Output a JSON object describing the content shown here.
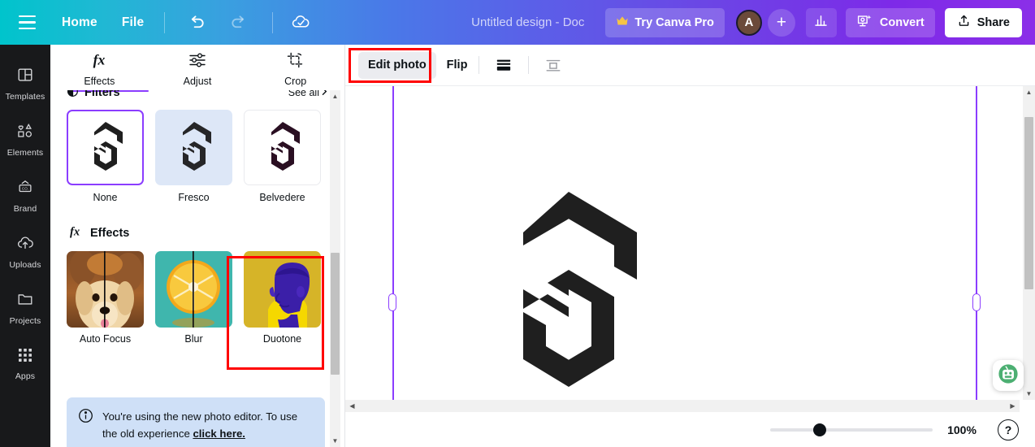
{
  "header": {
    "menu_icon": "hamburger-icon",
    "home_label": "Home",
    "file_label": "File",
    "undo_icon": "undo-icon",
    "redo_icon": "redo-icon",
    "cloud_save_icon": "cloud-check-icon",
    "doc_title": "Untitled design - Doc",
    "try_pro_label": "Try Canva Pro",
    "crown_icon": "crown-icon",
    "avatar_initial": "A",
    "add_member_label": "+",
    "insights_icon": "bar-chart-icon",
    "convert_label": "Convert",
    "convert_icon": "magic-convert-icon",
    "share_label": "Share",
    "share_icon": "share-upload-icon",
    "gradient_start": "#00c4cc",
    "gradient_end": "#8b2fe8"
  },
  "rail": {
    "items": [
      {
        "label": "Templates",
        "icon": "templates-icon"
      },
      {
        "label": "Elements",
        "icon": "elements-shapes-icon"
      },
      {
        "label": "Brand",
        "icon": "brand-icon"
      },
      {
        "label": "Uploads",
        "icon": "upload-cloud-icon"
      },
      {
        "label": "Projects",
        "icon": "folder-icon"
      },
      {
        "label": "Apps",
        "icon": "apps-grid-icon"
      }
    ]
  },
  "panel": {
    "tabs": [
      {
        "label": "Effects",
        "icon": "fx-icon",
        "active": true
      },
      {
        "label": "Adjust",
        "icon": "sliders-icon",
        "active": false
      },
      {
        "label": "Crop",
        "icon": "crop-icon",
        "active": false
      }
    ],
    "filters": {
      "title": "Filters",
      "title_icon": "filter-contrast-icon",
      "see_all_label": "See all",
      "see_all_icon": "chevron-right-icon",
      "items": [
        {
          "label": "None",
          "selected": true
        },
        {
          "label": "Fresco",
          "selected": false
        },
        {
          "label": "Belvedere",
          "selected": false
        }
      ]
    },
    "effects": {
      "title": "Effects",
      "title_icon": "fx-icon",
      "items": [
        {
          "label": "Auto Focus",
          "highlighted": false
        },
        {
          "label": "Blur",
          "highlighted": false
        },
        {
          "label": "Duotone",
          "highlighted": true
        }
      ]
    },
    "notice": {
      "icon": "info-icon",
      "text": "You're using the new photo editor. To use the old experience ",
      "link_text": "click here.",
      "background": "#cfe0f7"
    }
  },
  "toolbar": {
    "edit_photo_label": "Edit photo",
    "edit_photo_highlighted": true,
    "flip_label": "Flip",
    "spacing_icon": "line-spacing-icon",
    "position_icon": "position-align-icon"
  },
  "canvas": {
    "logo_name": "hexagon-s-logo",
    "logo_color": "#1f1f1f",
    "guide_color": "#8b3dff",
    "assistant_icon": "green-robot-assistant-icon"
  },
  "bottom_bar": {
    "zoom_value": "100%",
    "zoom_percent": 27,
    "help_label": "?"
  },
  "annotations": {
    "color": "#ff0000",
    "targets": [
      "edit-photo-button",
      "duotone-effect-thumbnail"
    ]
  }
}
